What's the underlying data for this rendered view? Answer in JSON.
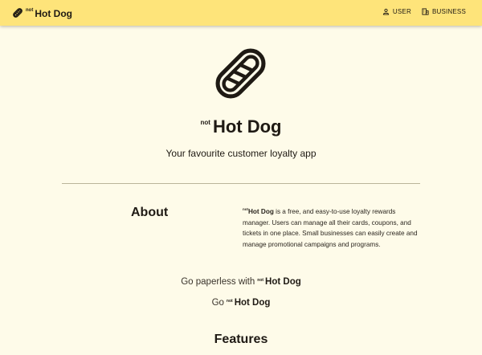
{
  "header": {
    "brand_not": "not",
    "brand_name": "Hot Dog",
    "nav": [
      {
        "label": "USER",
        "icon": "user-icon"
      },
      {
        "label": "BUSINESS",
        "icon": "building-icon"
      }
    ]
  },
  "hero": {
    "logo_icon": "hot-dog-icon",
    "title_not": "not",
    "title_name": "Hot Dog",
    "tagline": "Your favourite customer loyalty app"
  },
  "about": {
    "heading": "About",
    "brand_not": "not",
    "brand_name": "Hot Dog",
    "text": " is a free, and easy-to-use loyalty rewards manager. Users can manage all their cards, coupons, and tickets in one place. Small businesses can easily create and manage promotional campaigns and programs."
  },
  "taglines": {
    "line1_prefix": "Go paperless with",
    "line2_prefix": "Go",
    "brand_not": "not",
    "brand_name": "Hot Dog"
  },
  "features": {
    "heading": "Features"
  },
  "colors": {
    "header_bg": "#fee47a",
    "page_bg": "#fefbe9",
    "text": "#1f1a14"
  }
}
